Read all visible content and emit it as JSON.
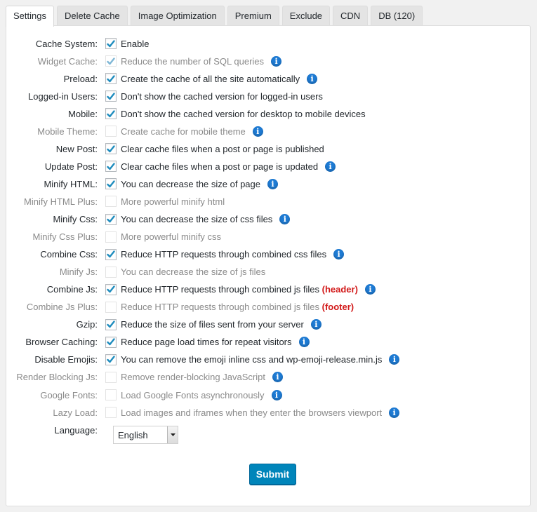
{
  "tabs": [
    {
      "label": "Settings",
      "active": true
    },
    {
      "label": "Delete Cache"
    },
    {
      "label": "Image Optimization"
    },
    {
      "label": "Premium"
    },
    {
      "label": "Exclude"
    },
    {
      "label": "CDN"
    },
    {
      "label": "DB (120)"
    }
  ],
  "settings": [
    {
      "label": "Cache System:",
      "desc": "Enable",
      "checked": true,
      "disabled": false,
      "info": false
    },
    {
      "label": "Widget Cache:",
      "desc": "Reduce the number of SQL queries",
      "checked": true,
      "disabled": true,
      "info": true
    },
    {
      "label": "Preload:",
      "desc": "Create the cache of all the site automatically",
      "checked": true,
      "disabled": false,
      "info": true
    },
    {
      "label": "Logged-in Users:",
      "desc": "Don't show the cached version for logged-in users",
      "checked": true,
      "disabled": false,
      "info": false
    },
    {
      "label": "Mobile:",
      "desc": "Don't show the cached version for desktop to mobile devices",
      "checked": true,
      "disabled": false,
      "info": false
    },
    {
      "label": "Mobile Theme:",
      "desc": "Create cache for mobile theme",
      "checked": false,
      "disabled": true,
      "info": true
    },
    {
      "label": "New Post:",
      "desc": "Clear cache files when a post or page is published",
      "checked": true,
      "disabled": false,
      "info": false
    },
    {
      "label": "Update Post:",
      "desc": "Clear cache files when a post or page is updated",
      "checked": true,
      "disabled": false,
      "info": true
    },
    {
      "label": "Minify HTML:",
      "desc": "You can decrease the size of page",
      "checked": true,
      "disabled": false,
      "info": true
    },
    {
      "label": "Minify HTML Plus:",
      "desc": "More powerful minify html",
      "checked": false,
      "disabled": true,
      "info": false
    },
    {
      "label": "Minify Css:",
      "desc": "You can decrease the size of css files",
      "checked": true,
      "disabled": false,
      "info": true
    },
    {
      "label": "Minify Css Plus:",
      "desc": "More powerful minify css",
      "checked": false,
      "disabled": true,
      "info": false
    },
    {
      "label": "Combine Css:",
      "desc": "Reduce HTTP requests through combined css files",
      "checked": true,
      "disabled": false,
      "info": true
    },
    {
      "label": "Minify Js:",
      "desc": "You can decrease the size of js files",
      "checked": false,
      "disabled": true,
      "info": false
    },
    {
      "label": "Combine Js:",
      "desc": "Reduce HTTP requests through combined js files",
      "highlight": "(header)",
      "checked": true,
      "disabled": false,
      "info": true
    },
    {
      "label": "Combine Js Plus:",
      "desc": "Reduce HTTP requests through combined js files",
      "highlight": "(footer)",
      "checked": false,
      "disabled": true,
      "info": false
    },
    {
      "label": "Gzip:",
      "desc": "Reduce the size of files sent from your server",
      "checked": true,
      "disabled": false,
      "info": true
    },
    {
      "label": "Browser Caching:",
      "desc": "Reduce page load times for repeat visitors",
      "checked": true,
      "disabled": false,
      "info": true
    },
    {
      "label": "Disable Emojis:",
      "desc": "You can remove the emoji inline css and wp-emoji-release.min.js",
      "checked": true,
      "disabled": false,
      "info": true
    },
    {
      "label": "Render Blocking Js:",
      "desc": "Remove render-blocking JavaScript",
      "checked": false,
      "disabled": true,
      "info": true
    },
    {
      "label": "Google Fonts:",
      "desc": "Load Google Fonts asynchronously",
      "checked": false,
      "disabled": true,
      "info": true
    },
    {
      "label": "Lazy Load:",
      "desc": "Load images and iframes when they enter the browsers viewport",
      "checked": false,
      "disabled": true,
      "info": true
    }
  ],
  "language": {
    "label": "Language:",
    "value": "English"
  },
  "submit_label": "Submit",
  "colors": {
    "accent": "#0085ba",
    "info": "#1e7bd4",
    "check": "#1e8cbe",
    "highlight": "#d21a1a"
  }
}
